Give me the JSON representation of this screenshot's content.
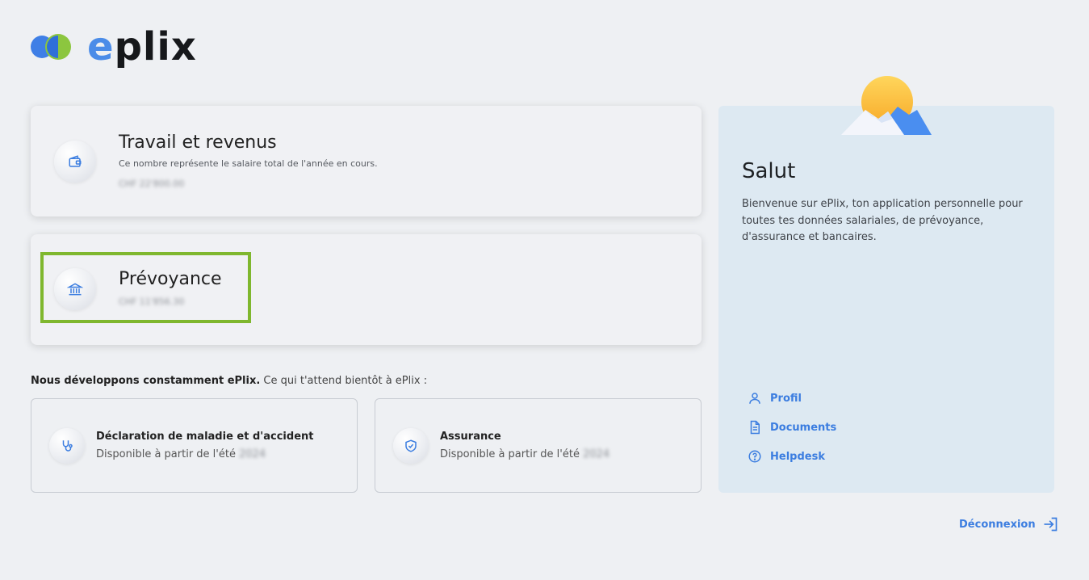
{
  "brand": {
    "name_e": "e",
    "name_rest": "plix"
  },
  "cards": [
    {
      "title": "Travail et revenus",
      "subtitle": "Ce nombre représente le salaire total de l'année en cours.",
      "amount": "CHF 22'800.00",
      "icon": "wallet-icon"
    },
    {
      "title": "Prévoyance",
      "amount": "CHF 11'856.30",
      "icon": "bank-icon"
    }
  ],
  "development": {
    "bold": "Nous développons constamment ePlix.",
    "light": " Ce qui t'attend bientôt à ePlix :"
  },
  "upcoming": [
    {
      "title": "Déclaration de maladie et d'accident",
      "subtitle": "Disponible à partir de l'été",
      "year": "2024",
      "icon": "stethoscope-icon"
    },
    {
      "title": "Assurance",
      "subtitle": "Disponible à partir de l'été",
      "year": "2024",
      "icon": "shield-check-icon"
    }
  ],
  "panel": {
    "title": "Salut",
    "text": "Bienvenue sur ePlix, ton application personnelle pour toutes tes données salariales, de prévoyance, d'assurance et bancaires.",
    "links": [
      {
        "label": "Profil",
        "icon": "user-icon"
      },
      {
        "label": "Documents",
        "icon": "document-icon"
      },
      {
        "label": "Helpdesk",
        "icon": "help-icon"
      }
    ]
  },
  "logout": {
    "label": "Déconnexion",
    "icon": "logout-icon"
  },
  "colors": {
    "accent": "#3b7de0",
    "highlight": "#7fb72e",
    "panel": "#dde9f2"
  }
}
